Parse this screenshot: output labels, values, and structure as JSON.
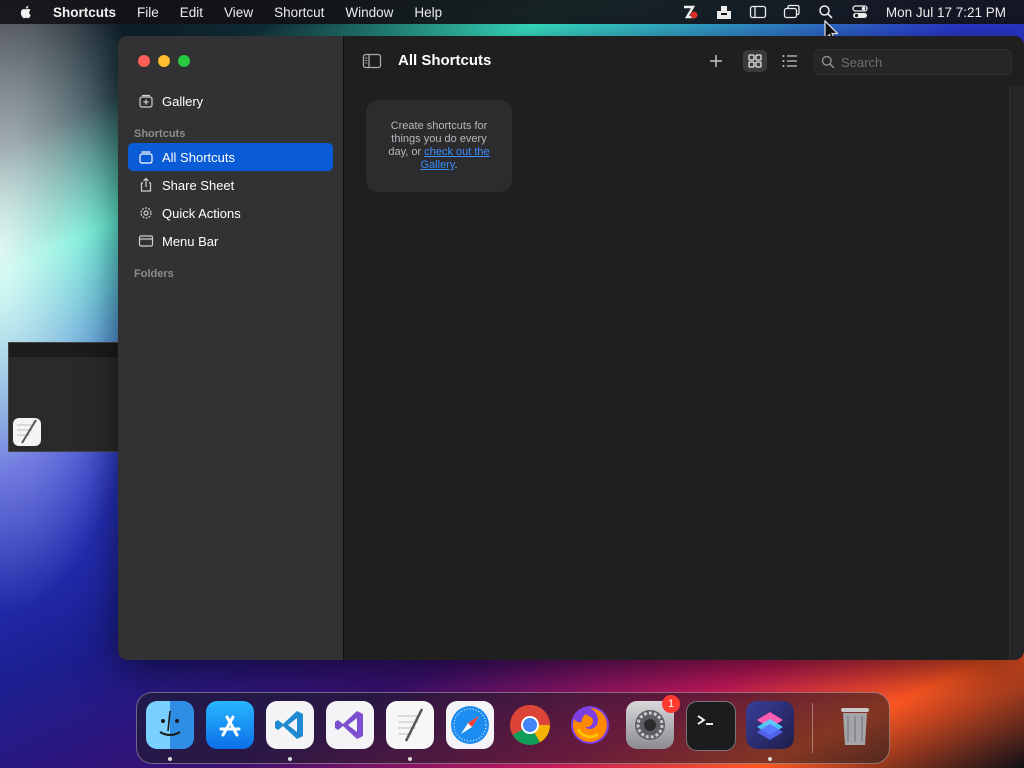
{
  "menubar": {
    "app_name": "Shortcuts",
    "menus": [
      "File",
      "Edit",
      "View",
      "Shortcut",
      "Window",
      "Help"
    ],
    "status_icons": [
      "creative-cloud-icon",
      "inbox-tray-icon",
      "sidebar-list-icon",
      "screen-mirroring-icon",
      "spotlight-search-icon",
      "control-center-icon"
    ],
    "clock": "Mon Jul 17  7:21 PM"
  },
  "sidebar": {
    "gallery_label": "Gallery",
    "shortcuts_header": "Shortcuts",
    "items": [
      {
        "label": "All Shortcuts",
        "icon": "stack-icon",
        "active": true
      },
      {
        "label": "Share Sheet",
        "icon": "share-icon",
        "active": false
      },
      {
        "label": "Quick Actions",
        "icon": "gear-icon",
        "active": false
      },
      {
        "label": "Menu Bar",
        "icon": "menubar-icon",
        "active": false
      }
    ],
    "folders_header": "Folders"
  },
  "main": {
    "title": "All Shortcuts",
    "search_placeholder": "Search",
    "empty_card": {
      "text": "Create shortcuts for things you do every day, or ",
      "link": "check out the Gallery",
      "end": "."
    }
  },
  "dock": {
    "apps": [
      {
        "name": "Finder",
        "icon": "finder-icon",
        "running": true
      },
      {
        "name": "App Store",
        "icon": "app-store-icon",
        "running": false
      },
      {
        "name": "Visual Studio Code",
        "icon": "vscode-icon",
        "running": true
      },
      {
        "name": "Visual Studio",
        "icon": "visual-studio-icon",
        "running": false
      },
      {
        "name": "TextEdit",
        "icon": "textedit-icon",
        "running": true
      },
      {
        "name": "Safari",
        "icon": "safari-icon",
        "running": false
      },
      {
        "name": "Chrome",
        "icon": "chrome-icon",
        "running": false
      },
      {
        "name": "Firefox",
        "icon": "firefox-icon",
        "running": false
      },
      {
        "name": "System Settings",
        "icon": "system-settings-icon",
        "running": false,
        "badge": "1"
      },
      {
        "name": "Terminal",
        "icon": "terminal-icon",
        "running": false
      },
      {
        "name": "Shortcuts",
        "icon": "shortcuts-icon",
        "running": true
      }
    ],
    "trash": {
      "name": "Trash",
      "icon": "trash-icon"
    }
  },
  "colors": {
    "accent": "#0a5bd6",
    "link": "#3c8dff",
    "sidebar_bg": "#323234",
    "main_bg": "#1f1f20"
  }
}
